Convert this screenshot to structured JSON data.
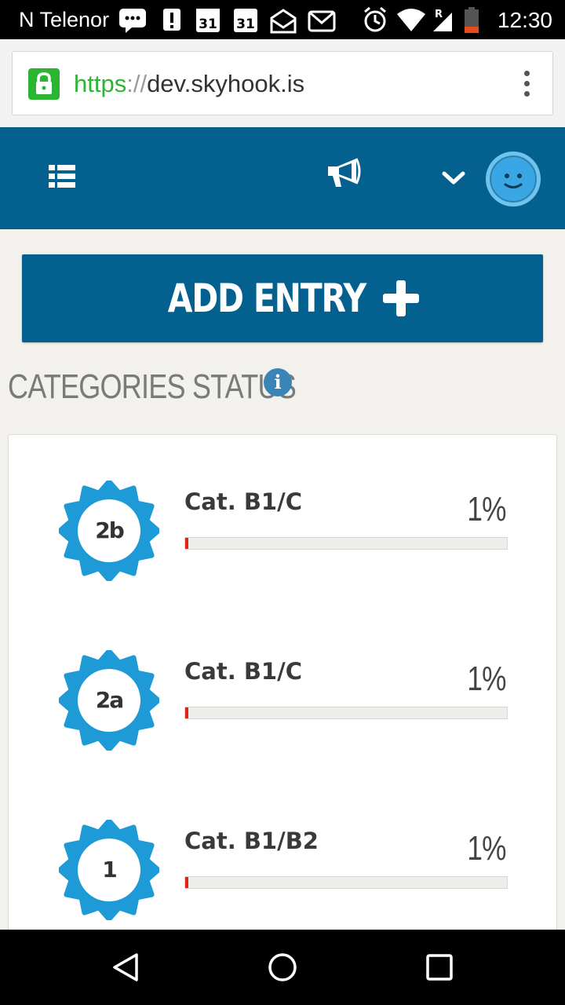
{
  "status_bar": {
    "carrier": "N Telenor",
    "time": "12:30",
    "calendar_day_1": "31",
    "calendar_day_2": "31",
    "roaming": "R",
    "icons": [
      "chat-icon",
      "alert-icon",
      "calendar-icon",
      "calendar-icon",
      "mail-open-icon",
      "gmail-icon",
      "alarm-icon",
      "wifi-icon",
      "signal-icon",
      "battery-icon"
    ]
  },
  "browser": {
    "url_scheme": "https",
    "url_separator": "://",
    "url_host": "dev.skyhook.is"
  },
  "header": {
    "menu_icon": "list-menu-icon",
    "announce_icon": "megaphone-icon",
    "dropdown_icon": "chevron-down-icon",
    "avatar_icon": "smiley-avatar-icon",
    "color": "#04608f"
  },
  "add_entry": {
    "label": "ADD ENTRY"
  },
  "categories": {
    "heading": "CATEGORIES STATUS",
    "info_glyph": "i",
    "items": [
      {
        "badge": "2b",
        "name": "Cat. B1/C",
        "percent_label": "1%",
        "progress": 0.01
      },
      {
        "badge": "2a",
        "name": "Cat. B1/C",
        "percent_label": "1%",
        "progress": 0.01
      },
      {
        "badge": "1",
        "name": "Cat. B1/B2",
        "percent_label": "1%",
        "progress": 0.01
      }
    ],
    "badge_color": "#1e9ad6",
    "progress_color": "#e2231a"
  },
  "nav": {
    "back_icon": "back-triangle-icon",
    "home_icon": "home-circle-icon",
    "recents_icon": "recents-square-icon"
  }
}
